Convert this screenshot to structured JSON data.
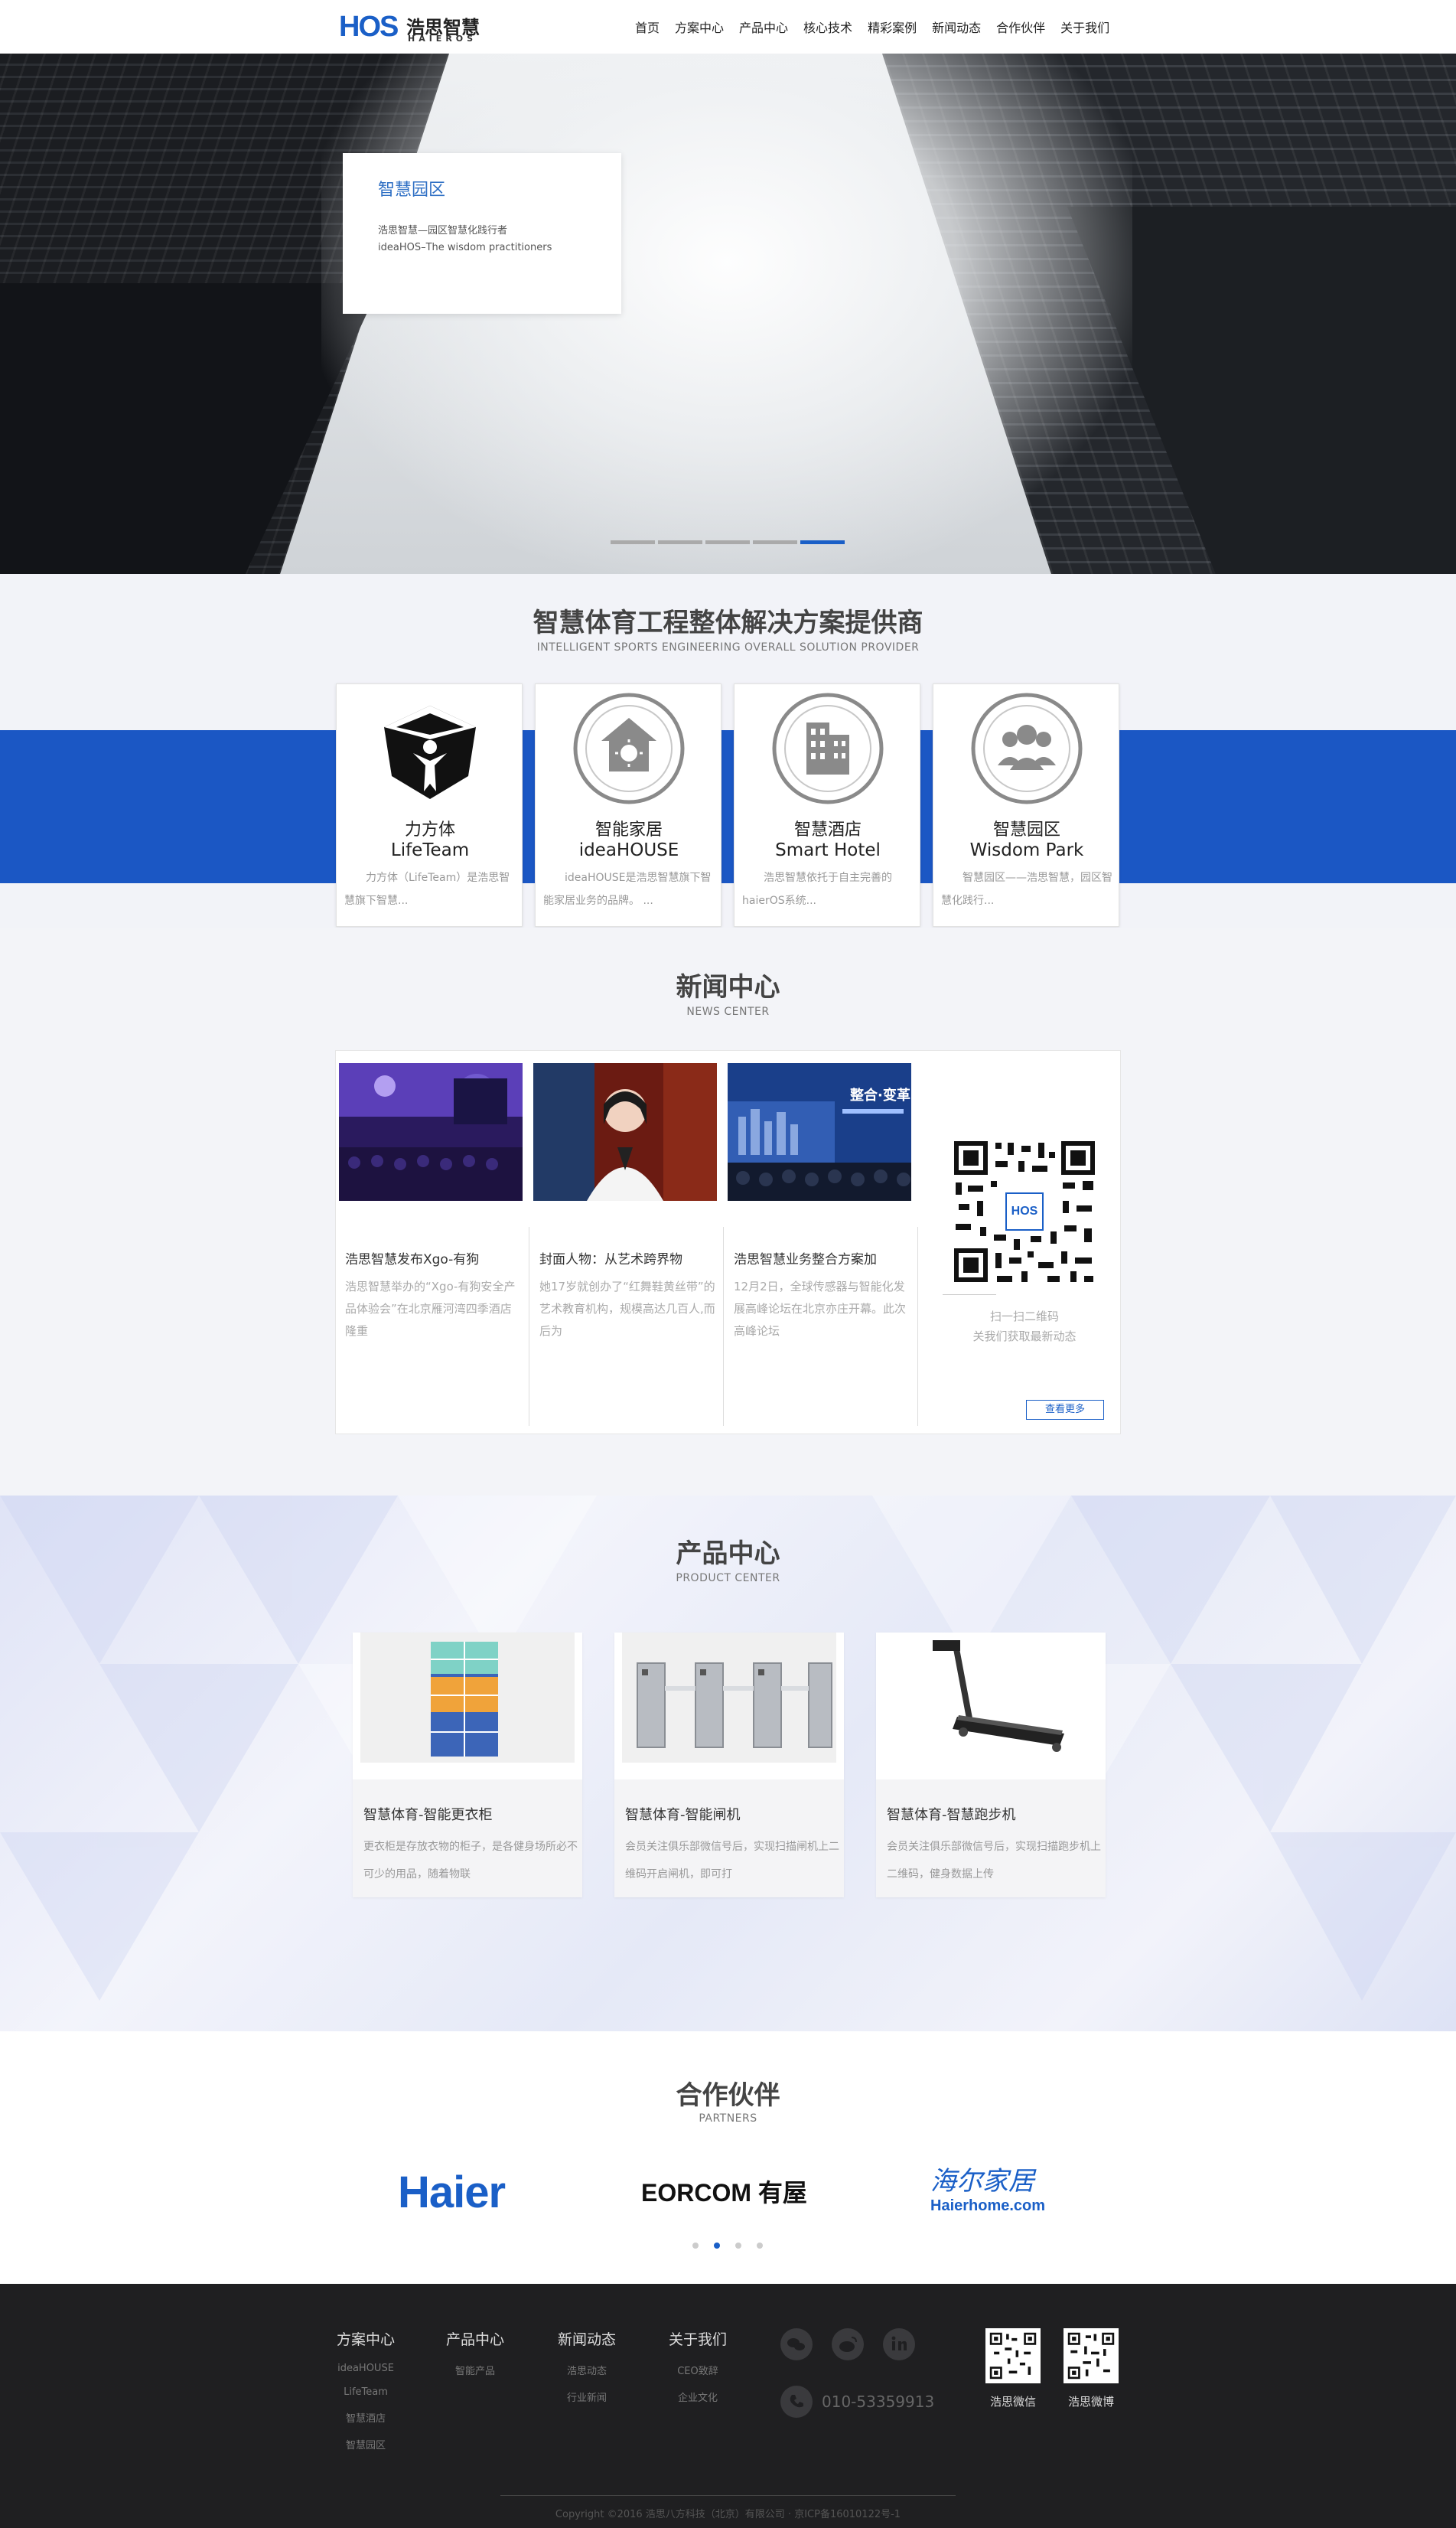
{
  "header": {
    "logo": {
      "mark": "HOS",
      "cn": "浩思智慧",
      "en": "HAIEROS"
    },
    "nav": [
      "首页",
      "方案中心",
      "产品中心",
      "核心技术",
      "精彩案例",
      "新闻动态",
      "合作伙伴",
      "关于我们"
    ]
  },
  "banner": {
    "card_title": "智慧园区",
    "card_line1": "浩思智慧—园区智慧化践行者",
    "card_line2": "ideaHOS–The wisdom practitioners",
    "slides": 5,
    "active_slide": 5
  },
  "solutions": {
    "title": "智慧体育工程整体解决方案提供商",
    "subtitle": "INTELLIGENT SPORTS ENGINEERING OVERALL SOLUTION PROVIDER",
    "items": [
      {
        "name": "力方体",
        "en": "LifeTeam",
        "desc": "力方体（LifeTeam）是浩思智慧旗下智慧...",
        "icon": "lifeteam-cube-icon"
      },
      {
        "name": "智能家居",
        "en": "ideaHOUSE",
        "desc": "ideaHOUSE是浩思智慧旗下智能家居业务的品牌。 ...",
        "icon": "house-icon"
      },
      {
        "name": "智慧酒店",
        "en": "Smart Hotel",
        "desc": "浩思智慧依托于自主完善的haierOS系统...",
        "icon": "hotel-building-icon"
      },
      {
        "name": "智慧园区",
        "en": "Wisdom Park",
        "desc": "智慧园区——浩思智慧，园区智慧化践行...",
        "icon": "park-people-icon"
      }
    ]
  },
  "news": {
    "title": "新闻中心",
    "subtitle": "NEWS CENTER",
    "items": [
      {
        "title": "浩思智慧发布Xgo-有狗",
        "desc": "浩思智慧举办的“Xgo-有狗安全产品体验会”在北京雁河湾四季酒店隆重"
      },
      {
        "title": "封面人物：从艺术跨界物",
        "desc": "她17岁就创办了“红舞鞋黄丝带”的艺术教育机构，规模高达几百人,而后为"
      },
      {
        "title": "浩思智慧业务整合方案加",
        "desc": "12月2日，全球传感器与智能化发展高峰论坛在北京亦庄开幕。此次高峰论坛"
      }
    ],
    "qr_text1": "扫一扫二维码",
    "qr_text2": "关我们获取最新动态",
    "more": "查看更多",
    "banner_text": "整合·变革"
  },
  "products": {
    "title": "产品中心",
    "subtitle": "PRODUCT CENTER",
    "items": [
      {
        "title": "智慧体育-智能更衣柜",
        "desc": "更衣柜是存放衣物的柜子，是各健身场所必不可少的用品，随着物联"
      },
      {
        "title": "智慧体育-智能闸机",
        "desc": "会员关注俱乐部微信号后，实现扫描闸机上二维码开启闸机，即可打"
      },
      {
        "title": "智慧体育-智慧跑步机",
        "desc": "会员关注俱乐部微信号后，实现扫描跑步机上二维码，健身数据上传"
      }
    ]
  },
  "partners": {
    "title": "合作伙伴",
    "subtitle": "PARTNERS",
    "logos": [
      "Haier",
      "EORCOM 有屋",
      "海尔家居",
      "Haierhome.com"
    ],
    "pages": 4,
    "active_page": 2
  },
  "footer": {
    "columns": [
      {
        "head": "方案中心",
        "items": [
          "ideaHOUSE",
          "LifeTeam",
          "智慧酒店",
          "智慧园区"
        ]
      },
      {
        "head": "产品中心",
        "items": [
          "智能产品"
        ]
      },
      {
        "head": "新闻动态",
        "items": [
          "浩思动态",
          "行业新闻"
        ]
      },
      {
        "head": "关于我们",
        "items": [
          "CEO致辞",
          "企业文化"
        ]
      }
    ],
    "social": [
      "wechat-icon",
      "weibo-icon",
      "linkedin-icon"
    ],
    "phone": "010-53359913",
    "qr_labels": [
      "浩思微信",
      "浩思微博"
    ],
    "copyright": "Copyright ©2016 浩思八方科技（北京）有限公司 · 京ICP备16010122号-1"
  },
  "colors": {
    "brand_blue": "#1a5fc7",
    "band_blue": "#1b57c4",
    "footer_bg": "#1f1f21"
  }
}
